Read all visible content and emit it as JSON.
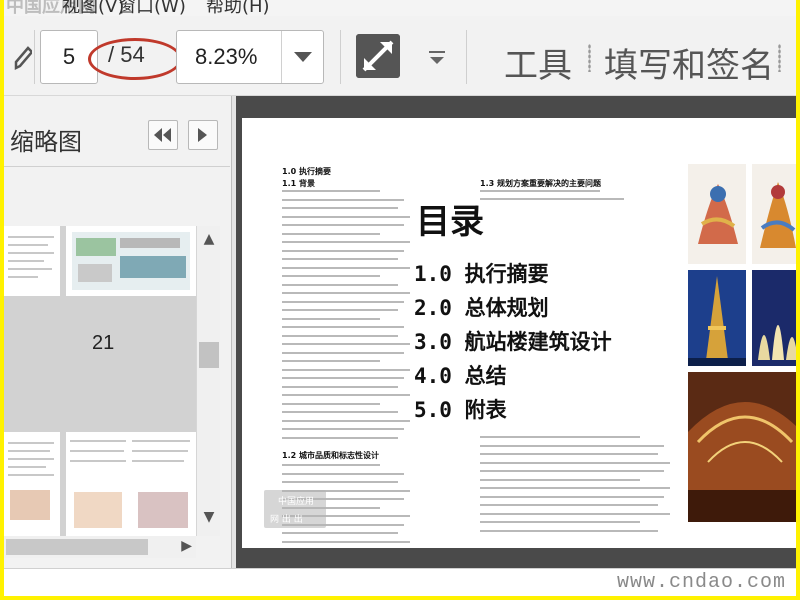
{
  "menubar": {
    "items": [
      "视图(V)",
      "窗口(W)",
      "帮助(H)"
    ],
    "logo": "中国应用网"
  },
  "toolbar": {
    "current_page": "5",
    "page_total": "/ 54",
    "zoom": "8.23%",
    "tools_label": "工具",
    "fill_sign_label": "填写和签名"
  },
  "sidebar": {
    "title": "缩略图",
    "thumbnail_page_number": "21"
  },
  "document": {
    "left_heading_1": "1.0 执行摘要",
    "left_heading_2": "1.1 背景",
    "right_heading": "1.3 规划方案重要解决的主要问题",
    "left_heading_3": "1.2 城市品质和标志性设计",
    "toc_title": "目录",
    "toc_items": [
      "1.0 执行摘要",
      "2.0 总体规划",
      "3.0 航站楼建筑设计",
      "4.0 总结",
      "5.0 附表"
    ],
    "stamp_lines": [
      "中国应用",
      "网  出  出"
    ]
  },
  "watermark": "www.cndao.com",
  "colors": {
    "frame": "#fff200",
    "annotation_ellipse": "#c0392b",
    "doc_background": "#4a4a4a"
  }
}
